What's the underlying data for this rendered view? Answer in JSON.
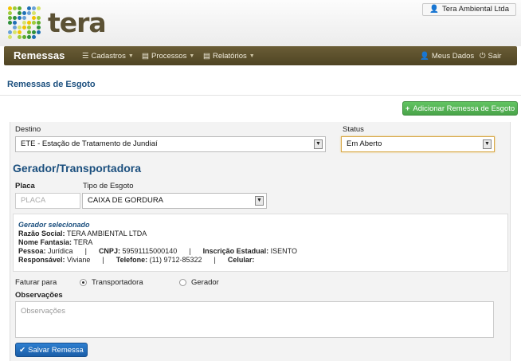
{
  "header": {
    "logo_text": "tera",
    "account_label": "Tera Ambiental Ltda"
  },
  "nav": {
    "brand": "Remessas",
    "items": [
      {
        "label": "Cadastros"
      },
      {
        "label": "Processos"
      },
      {
        "label": "Relatórios"
      }
    ],
    "meus_dados": "Meus Dados",
    "sair": "Sair"
  },
  "page": {
    "title": "Remessas de Esgoto",
    "add_button": "Adicionar Remessa de Esgoto"
  },
  "form": {
    "destino_label": "Destino",
    "destino_value": "ETE - Estação de Tratamento de Jundiaí",
    "status_label": "Status",
    "status_value": "Em Aberto",
    "section_title": "Gerador/Transportadora",
    "placa_label": "Placa",
    "placa_placeholder": "PLACA",
    "tipo_label": "Tipo de Esgoto",
    "tipo_value": "CAIXA DE GORDURA",
    "gerador": {
      "heading": "Gerador selecionado",
      "razao_label": "Razão Social:",
      "razao_value": "TERA AMBIENTAL LTDA",
      "fantasia_label": "Nome Fantasia:",
      "fantasia_value": "TERA",
      "pessoa_label": "Pessoa:",
      "pessoa_value": "Jurídica",
      "cnpj_label": "CNPJ:",
      "cnpj_value": "59591115000140",
      "ie_label": "Inscrição Estadual:",
      "ie_value": "ISENTO",
      "responsavel_label": "Responsável:",
      "responsavel_value": "Viviane",
      "telefone_label": "Telefone:",
      "telefone_value": "(11) 9712-85322",
      "celular_label": "Celular:",
      "separator": "|"
    },
    "faturar_label": "Faturar para",
    "faturar_options": [
      "Transportadora",
      "Gerador"
    ],
    "faturar_selected": "Transportadora",
    "obs_label": "Observações",
    "obs_placeholder": "Observações",
    "save_button": "Salvar Remessa"
  },
  "colors": {
    "navbar": "#5a4e2c",
    "accent_blue": "#1b4f7e",
    "add_green": "#4aa44a",
    "save_blue": "#1a5ea8"
  }
}
